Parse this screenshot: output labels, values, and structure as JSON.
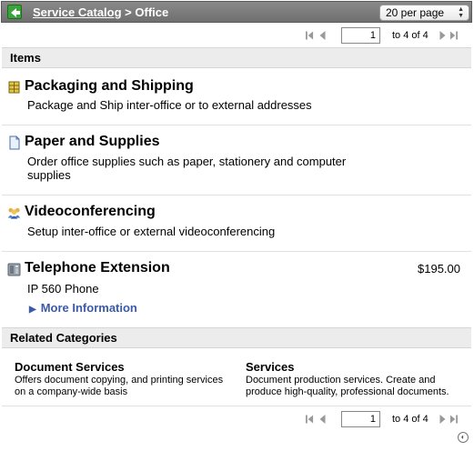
{
  "header": {
    "breadcrumb_link": "Service Catalog",
    "breadcrumb_separator": " > ",
    "breadcrumb_current": "Office",
    "per_page_value": "20 per page"
  },
  "pager": {
    "page_value": "1",
    "of_text": "to 4 of 4"
  },
  "items_section": {
    "label": "Items"
  },
  "items": [
    {
      "title": "Packaging and Shipping",
      "description": "Package and Ship inter-office or to external addresses",
      "icon": "package-icon"
    },
    {
      "title": "Paper and Supplies",
      "description": "Order office supplies such as paper, stationery and computer supplies",
      "icon": "paper-icon"
    },
    {
      "title": "Videoconferencing",
      "description": "Setup inter-office or external videoconferencing",
      "icon": "people-icon"
    },
    {
      "title": "Telephone Extension",
      "description": "IP 560 Phone",
      "price": "$195.00",
      "more_info": "More Information",
      "icon": "telephone-icon"
    }
  ],
  "related_section": {
    "label": "Related Categories"
  },
  "related": [
    {
      "title": "Document Services",
      "description": "Offers document copying, and printing services on a company-wide basis"
    },
    {
      "title": "Services",
      "description": "Document production services. Create and produce high-quality, professional documents."
    }
  ],
  "colors": {
    "header_bg": "#7d7d7d",
    "section_bg": "#ececec",
    "link_blue": "#3b5aa8",
    "back_green": "#3aa33a"
  }
}
